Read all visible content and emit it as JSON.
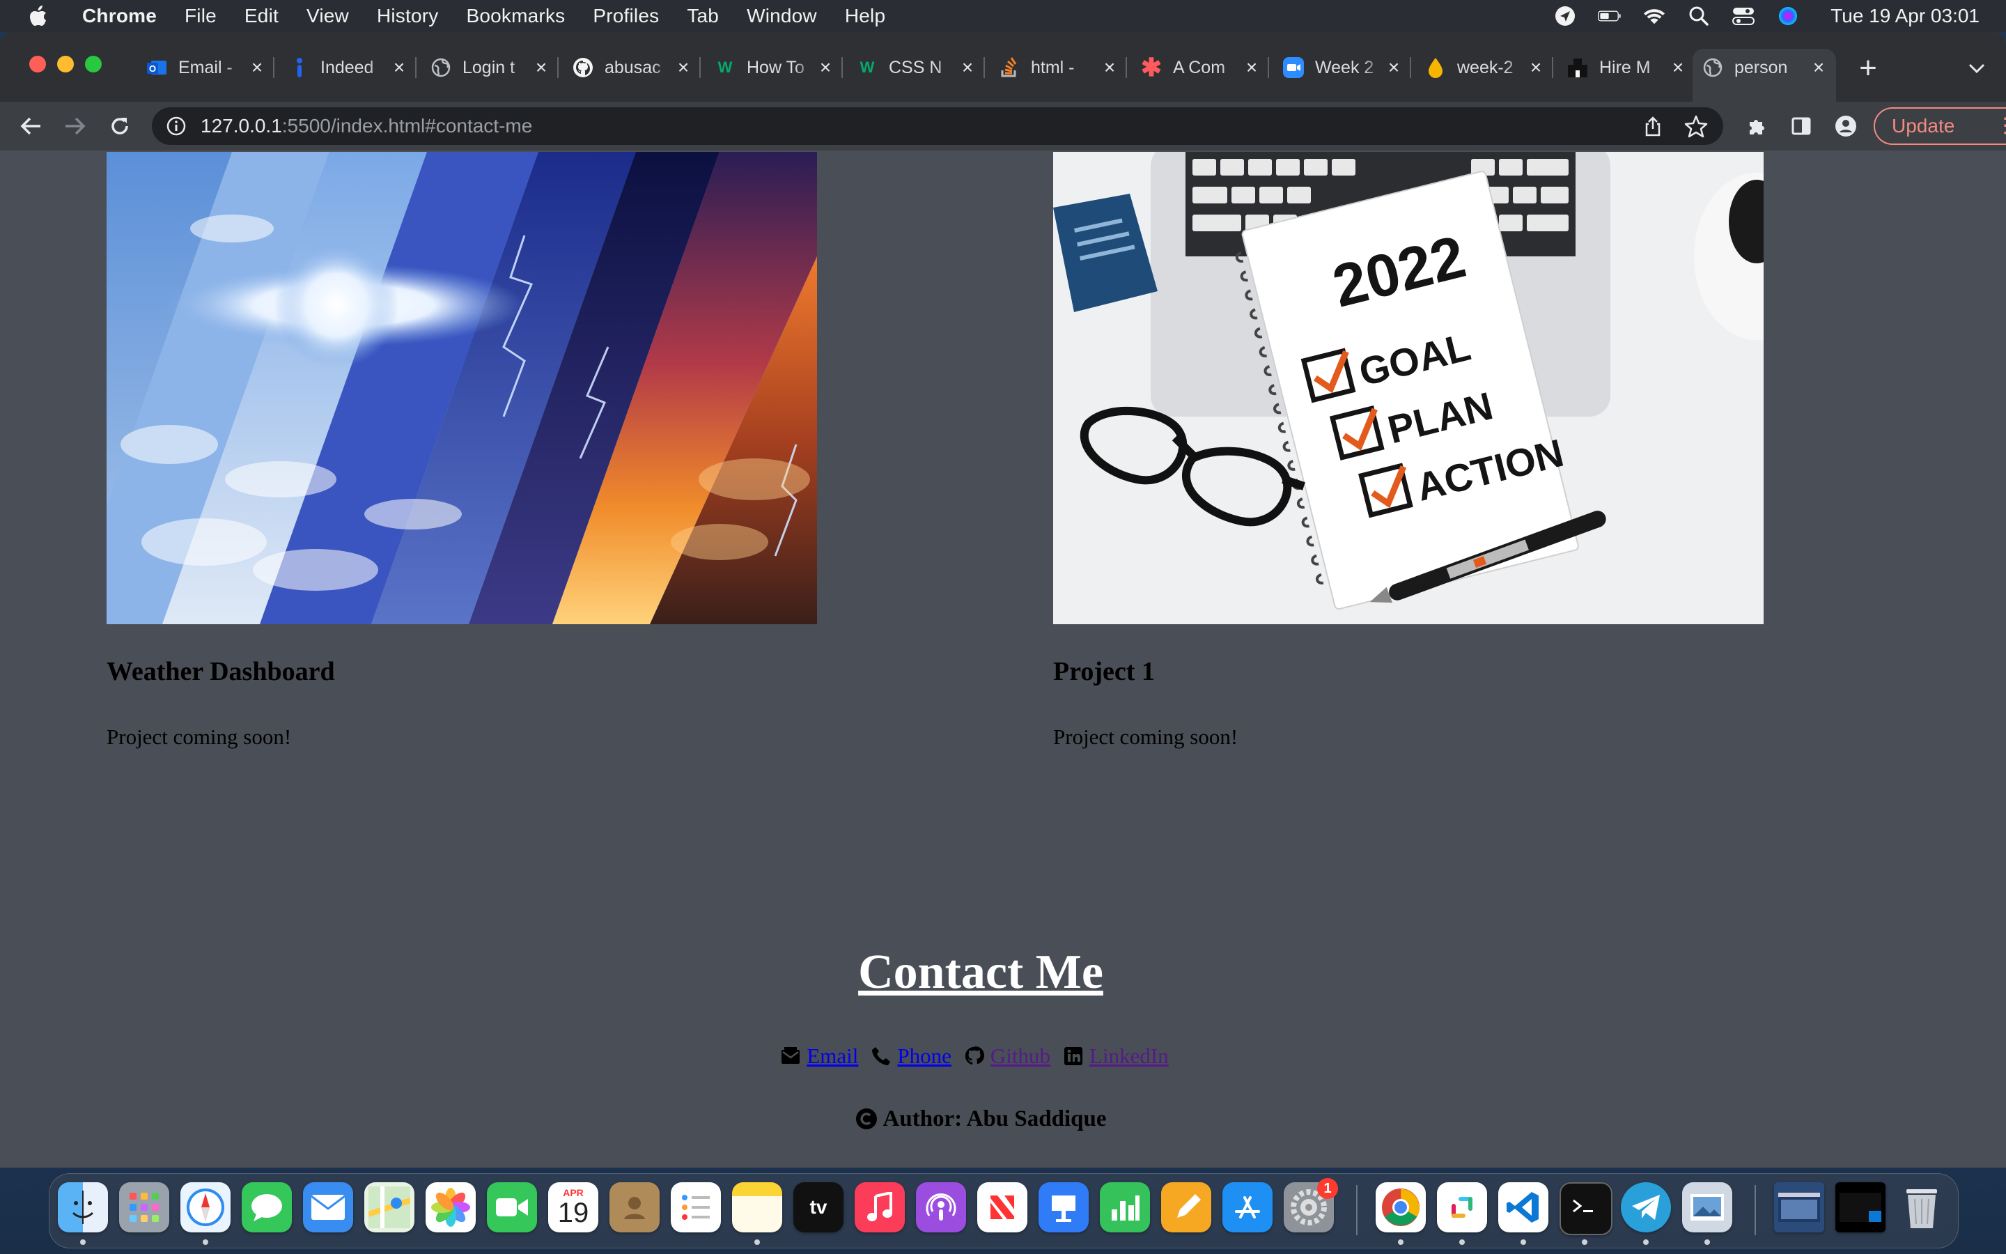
{
  "menubar": {
    "app_name": "Chrome",
    "items": [
      "File",
      "Edit",
      "View",
      "History",
      "Bookmarks",
      "Profiles",
      "Tab",
      "Window",
      "Help"
    ],
    "clock": "Tue 19 Apr  03:01"
  },
  "tabs": [
    {
      "title": "Email -",
      "icon": "outlook-icon"
    },
    {
      "title": "Indeed",
      "icon": "indeed-icon"
    },
    {
      "title": "Login t",
      "icon": "globe-icon"
    },
    {
      "title": "abusac",
      "icon": "github-icon"
    },
    {
      "title": "How To",
      "icon": "w3-icon"
    },
    {
      "title": "CSS N",
      "icon": "w3-icon"
    },
    {
      "title": "html -",
      "icon": "stackoverflow-icon"
    },
    {
      "title": "A Com",
      "icon": "asterisk-icon"
    },
    {
      "title": "Week 2",
      "icon": "zoom-icon"
    },
    {
      "title": "week-2",
      "icon": "drop-icon"
    },
    {
      "title": "Hire M",
      "icon": "upwork-icon"
    },
    {
      "title": "person",
      "icon": "globe-icon",
      "active": true
    }
  ],
  "toolbar": {
    "url_host": "127.0.0.1",
    "url_rest": ":5500/index.html#contact-me",
    "update_label": "Update"
  },
  "projects": [
    {
      "title": "Weather Dashboard",
      "description": "Project coming soon!",
      "image": "weather-collage"
    },
    {
      "title": "Project 1",
      "description": "Project coming soon!",
      "image": "2022 goal plan action notebook"
    }
  ],
  "notebook": {
    "year": "2022",
    "items": [
      "GOAL",
      "PLAN",
      "ACTION"
    ]
  },
  "contact": {
    "title": "Contact Me",
    "links": [
      {
        "label": "Email",
        "icon": "envelope-icon",
        "color": "#0000ee"
      },
      {
        "label": "Phone",
        "icon": "phone-icon",
        "color": "#0000ee"
      },
      {
        "label": "Github",
        "icon": "github-icon",
        "color": "#551a8b"
      },
      {
        "label": "LinkedIn",
        "icon": "linkedin-icon",
        "color": "#551a8b"
      }
    ],
    "author": "Author: Abu Saddique"
  },
  "dock": {
    "calendar": {
      "month": "APR",
      "day": "19"
    },
    "settings_badge": "1",
    "tv_label": "tv"
  },
  "colors": {
    "page_bg": "#4a4e56",
    "tab_bg": "#2e3033",
    "toolbar_bg": "#3c3f43",
    "update_accent": "#f28b82"
  }
}
